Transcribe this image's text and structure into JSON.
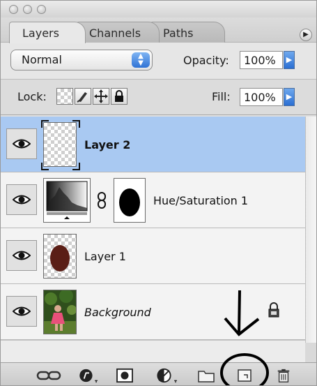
{
  "tabs": [
    {
      "label": "Layers",
      "active": true
    },
    {
      "label": "Channels",
      "active": false
    },
    {
      "label": "Paths",
      "active": false
    }
  ],
  "blend_mode": {
    "value": "Normal"
  },
  "opacity": {
    "label": "Opacity:",
    "value": "100%"
  },
  "lock": {
    "label": "Lock:"
  },
  "fill": {
    "label": "Fill:",
    "value": "100%"
  },
  "layers": [
    {
      "name": "Layer 2",
      "selected": true,
      "italic": false
    },
    {
      "name": "Hue/Saturation 1",
      "selected": false,
      "italic": false
    },
    {
      "name": "Layer 1",
      "selected": false,
      "italic": false
    },
    {
      "name": "Background",
      "selected": false,
      "italic": true,
      "locked": true
    }
  ],
  "colors": {
    "selection": "#a9c9f2",
    "accent_blue": "#2f72d5",
    "layer1_shape": "#5a1e16"
  },
  "toolbar_icons": [
    "link-layers-icon",
    "layer-style-icon",
    "layer-mask-icon",
    "adjustment-layer-icon",
    "new-group-icon",
    "new-layer-icon",
    "trash-icon"
  ]
}
